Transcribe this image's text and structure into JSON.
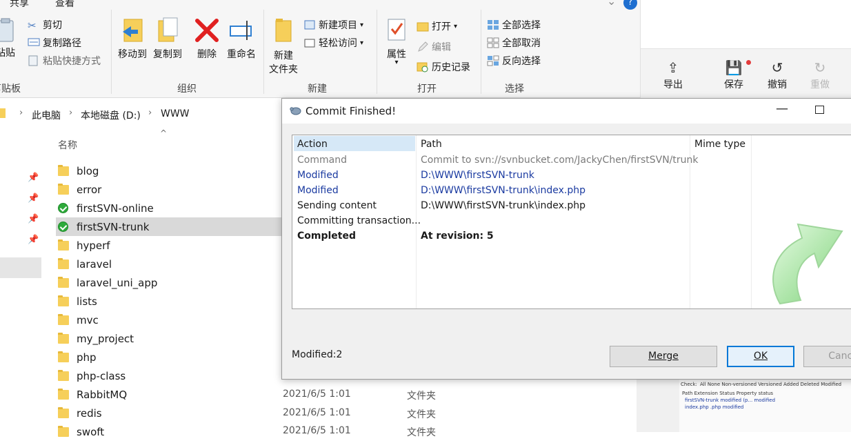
{
  "ribbon": {
    "tabs": [
      "共享",
      "查看"
    ],
    "clipboard": {
      "paste_label": "粘贴",
      "cut_label": "剪切",
      "copy_path_label": "复制路径",
      "paste_shortcut_label": "粘贴快捷方式",
      "group_label": "剪贴板"
    },
    "organize": {
      "move_to_label": "移动到",
      "copy_to_label": "复制到",
      "delete_label": "删除",
      "rename_label": "重命名",
      "group_label": "组织"
    },
    "new": {
      "new_folder_label_1": "新建",
      "new_folder_label_2": "文件夹",
      "new_item_label": "新建项目",
      "easy_access_label": "轻松访问",
      "group_label": "新建"
    },
    "open": {
      "properties_label": "属性",
      "open_label": "打开",
      "edit_label": "编辑",
      "history_label": "历史记录",
      "group_label": "打开"
    },
    "select": {
      "select_all_label": "全部选择",
      "select_none_label": "全部取消",
      "invert_label": "反向选择",
      "group_label": "选择"
    },
    "help": "?"
  },
  "address": {
    "crumbs": [
      "此电脑",
      "本地磁盘 (D:)",
      "WWW"
    ]
  },
  "file_list": {
    "column_name": "名称",
    "files": [
      {
        "name": "blog",
        "svn": false
      },
      {
        "name": "error",
        "svn": false
      },
      {
        "name": "firstSVN-online",
        "svn": true
      },
      {
        "name": "firstSVN-trunk",
        "svn": true,
        "selected": true
      },
      {
        "name": "hyperf",
        "svn": false
      },
      {
        "name": "laravel",
        "svn": false
      },
      {
        "name": "laravel_uni_app",
        "svn": false
      },
      {
        "name": "lists",
        "svn": false
      },
      {
        "name": "mvc",
        "svn": false
      },
      {
        "name": "my_project",
        "svn": false
      },
      {
        "name": "php",
        "svn": false
      },
      {
        "name": "php-class",
        "svn": false
      },
      {
        "name": "RabbitMQ",
        "svn": false
      },
      {
        "name": "redis",
        "svn": false
      },
      {
        "name": "swoft",
        "svn": false
      }
    ],
    "visible_meta": [
      {
        "date": "2021/6/5 1:01",
        "type": "文件夹"
      },
      {
        "date": "2021/6/5 1:01",
        "type": "文件夹"
      },
      {
        "date": "2021/6/5 1:01",
        "type": "文件夹"
      },
      {
        "date": "2021/6/5 1:01",
        "type": "文件夹"
      }
    ]
  },
  "right_app": {
    "tools": [
      {
        "label": "导出",
        "icon": "export-icon"
      },
      {
        "label": "保存",
        "icon": "save-icon"
      },
      {
        "label": "撤销",
        "icon": "undo-icon"
      },
      {
        "label": "重做",
        "icon": "redo-icon"
      }
    ]
  },
  "dialog": {
    "title": "Commit Finished!",
    "columns": [
      "Action",
      "Path",
      "Mime type"
    ],
    "rows": [
      {
        "action": "Command",
        "path": "Commit to svn://svnbucket.com/JackyChen/firstSVN/trunk",
        "style": "gray"
      },
      {
        "action": "Modified",
        "path": "D:\\WWW\\firstSVN-trunk",
        "style": "blue"
      },
      {
        "action": "Modified",
        "path": "D:\\WWW\\firstSVN-trunk\\index.php",
        "style": "blue"
      },
      {
        "action": "Sending content",
        "path": "D:\\WWW\\firstSVN-trunk\\index.php",
        "style": "black"
      },
      {
        "action": "Committing transaction...",
        "path": "",
        "style": "black"
      },
      {
        "action": "Completed",
        "path": "At revision: 5",
        "style": "bold"
      }
    ],
    "status": "Modified:2",
    "buttons": {
      "merge": "Merge",
      "ok": "OK",
      "cancel": "Cancel"
    }
  },
  "thumbnail": {
    "check_label": "Check:",
    "filters": "All  None  Non-versioned  Versioned  Added  Deleted  Modified",
    "headers": "Path                     Extension   Status          Property status",
    "row1": "firstSVN-trunk                          modified (p...   modified",
    "row2": "index.php                  .php        modified"
  }
}
